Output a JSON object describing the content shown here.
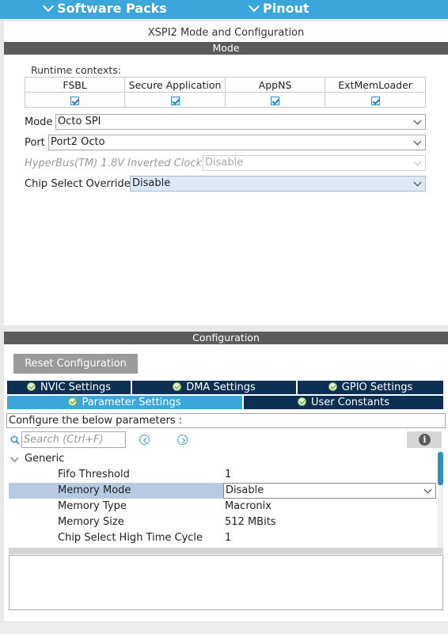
{
  "topbar": {
    "software_packs": "Software Packs",
    "pinout": "Pinout"
  },
  "title": "XSPI2 Mode and Configuration",
  "mode_section": {
    "header": "Mode",
    "runtime_label": "Runtime contexts:",
    "contexts": [
      {
        "label": "FSBL",
        "checked": true
      },
      {
        "label": "Secure Application",
        "checked": true
      },
      {
        "label": "AppNS",
        "checked": true
      },
      {
        "label": "ExtMemLoader",
        "checked": true
      }
    ],
    "fields": {
      "mode": {
        "label": "Mode",
        "value": "Octo SPI"
      },
      "port": {
        "label": "Port",
        "value": "Port2 Octo"
      },
      "hyperbus": {
        "label": "HyperBus(TM) 1.8V Inverted Clock",
        "value": "Disable"
      },
      "chip_select": {
        "label": "Chip Select Override",
        "value": "Disable"
      }
    }
  },
  "config_section": {
    "header": "Configuration",
    "reset_button": "Reset Configuration",
    "tabs": {
      "nvic": "NVIC Settings",
      "dma": "DMA Settings",
      "gpio": "GPIO Settings",
      "parameter": "Parameter Settings",
      "user_constants": "User Constants"
    },
    "configure_text": "Configure the below parameters :",
    "search_placeholder": "Search (Ctrl+F)",
    "group": "Generic",
    "params": [
      {
        "key": "Fifo Threshold",
        "value": "1"
      },
      {
        "key": "Memory Mode",
        "value": "Disable"
      },
      {
        "key": "Memory Type",
        "value": "Macronix"
      },
      {
        "key": "Memory Size",
        "value": "512 MBits"
      },
      {
        "key": "Chip Select High Time Cycle",
        "value": "1"
      }
    ]
  }
}
